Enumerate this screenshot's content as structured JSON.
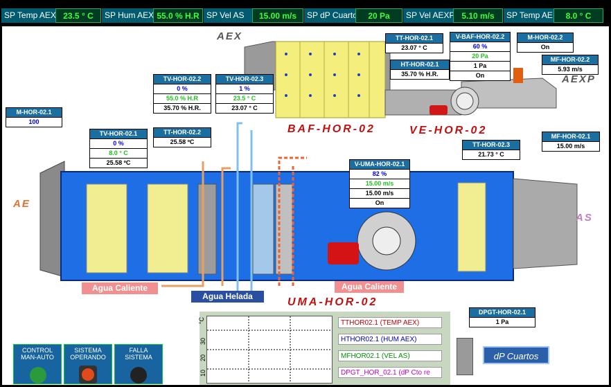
{
  "setpoints": [
    {
      "label": "SP Temp AEX",
      "value": "23.5 ° C"
    },
    {
      "label": "SP Hum AEX",
      "value": "55.0 % H.R"
    },
    {
      "label": "SP Vel AS",
      "value": "15.00 m/s"
    },
    {
      "label": "SP dP Cuarto",
      "value": "20 Pa"
    },
    {
      "label": "SP Vel AEXP",
      "value": "5.10 m/s"
    },
    {
      "label": "SP Temp AE",
      "value": "8.0 ° C"
    }
  ],
  "io_labels": {
    "aex": "AEX",
    "aexp": "AEXP",
    "ae": "AE",
    "as": "AS"
  },
  "equipment": {
    "baf": "BAF-HOR-02",
    "ve": "VE-HOR-02",
    "uma": "UMA-HOR-02"
  },
  "pipes": {
    "hot1": "Agua Caliente",
    "hot2": "Agua Caliente",
    "cold": "Agua Helada"
  },
  "tags": {
    "tt_hor_02_1": {
      "title": "TT-HOR-02.1",
      "rows": [
        "23.07 ° C"
      ]
    },
    "v_baf_hor_02_2": {
      "title": "V-BAF-HOR-02.2",
      "rows": [
        "60 %",
        "20 Pa",
        "1 Pa",
        "On"
      ]
    },
    "m_hor_02_2": {
      "title": "M-HOR-02.2",
      "rows": [
        "On"
      ]
    },
    "ht_hor_02_1": {
      "title": "HT-HOR-02.1",
      "rows": [
        "35.70 % H.R."
      ]
    },
    "mf_hor_02_2": {
      "title": "MF-HOR-02.2",
      "rows": [
        "5.93 m/s"
      ]
    },
    "tv_hor_02_2": {
      "title": "TV-HOR-02.2",
      "rows": [
        "0 %",
        "55.0 % H.R",
        "35.70 % H.R."
      ]
    },
    "tv_hor_02_3": {
      "title": "TV-HOR-02.3",
      "rows": [
        "1 %",
        "23.5 ° C",
        "23.07 ° C"
      ]
    },
    "m_hor_02_1": {
      "title": "M-HOR-02.1",
      "rows": [
        "100"
      ]
    },
    "tv_hor_02_1": {
      "title": "TV-HOR-02.1",
      "rows": [
        "0 %",
        "8.0 ° C",
        "25.58 ºC"
      ]
    },
    "tt_hor_02_2": {
      "title": "TT-HOR-02.2",
      "rows": [
        "25.58 ºC"
      ]
    },
    "tt_hor_02_3": {
      "title": "TT-HOR-02.3",
      "rows": [
        "21.73 ° C"
      ]
    },
    "mf_hor_02_1": {
      "title": "MF-HOR-02.1",
      "rows": [
        "15.00 m/s"
      ]
    },
    "v_uma_hor_02_1": {
      "title": "V-UMA-HOR-02.1",
      "rows": [
        "82 %",
        "15.00 m/s",
        "15.00 m/s",
        "On"
      ]
    },
    "dpgt_hor_02_1": {
      "title": "DPGT-HOR-02.1",
      "rows": [
        "1 Pa"
      ]
    }
  },
  "trend": {
    "y_unit": "°C",
    "y_ticks": [
      "30",
      "20",
      "10"
    ],
    "legend": [
      "TTHOR02.1 (TEMP AEX)",
      "HTHOR02.1 (HUM AEX)",
      "MFHOR02.1 (VEL AS)",
      "DPGT_HOR_02.1 (dP Cto re"
    ]
  },
  "controls": [
    {
      "label": "CONTROL MAN-AUTO",
      "color": "#2a9a3c"
    },
    {
      "label": "SISTEMA OPERANDO",
      "color": "#e04a1c"
    },
    {
      "label": "FALLA SISTEMA",
      "color": "#222222"
    }
  ],
  "dp_button": "dP Cuartos",
  "colors": {
    "duct": "#1e6ee6",
    "hot": "#e05020",
    "cold": "#4aa0e0",
    "tag_header": "#1a6fa0"
  }
}
